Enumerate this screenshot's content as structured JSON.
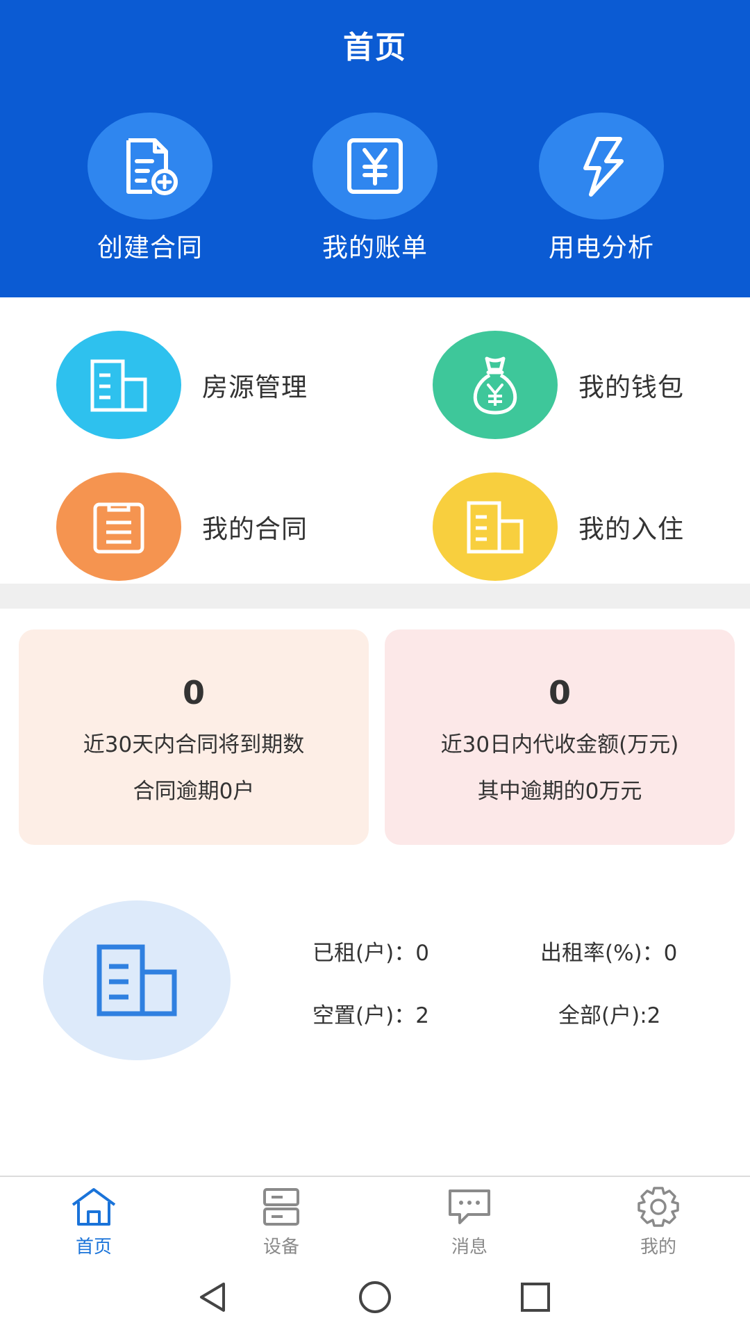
{
  "header": {
    "title": "首页",
    "actions": [
      {
        "label": "创建合同",
        "icon": "document-add-icon"
      },
      {
        "label": "我的账单",
        "icon": "yuan-bill-icon"
      },
      {
        "label": "用电分析",
        "icon": "lightning-icon"
      }
    ]
  },
  "grid": [
    {
      "label": "房源管理",
      "icon": "building-icon",
      "color": "#2ec1ee"
    },
    {
      "label": "我的钱包",
      "icon": "money-bag-icon",
      "color": "#3ec79a"
    },
    {
      "label": "我的合同",
      "icon": "clipboard-icon",
      "color": "#f59450"
    },
    {
      "label": "我的入住",
      "icon": "building-icon",
      "color": "#f8cf3e"
    }
  ],
  "cards": [
    {
      "value": "0",
      "line1": "近30天内合同将到期数",
      "line2": "合同逾期0户",
      "bg": "#fdeee6"
    },
    {
      "value": "0",
      "line1": "近30日内代收金额(万元)",
      "line2": "其中逾期的0万元",
      "bg": "#fce8e8"
    }
  ],
  "summary": {
    "icon": "building-icon",
    "rented": "已租(户)：0",
    "rate": "出租率(%)：0",
    "vacant": "空置(户)：2",
    "total": "全部(户):2"
  },
  "tabs": [
    {
      "label": "首页",
      "icon": "home-icon",
      "active": true
    },
    {
      "label": "设备",
      "icon": "device-icon",
      "active": false
    },
    {
      "label": "消息",
      "icon": "message-icon",
      "active": false
    },
    {
      "label": "我的",
      "icon": "gear-icon",
      "active": false
    }
  ],
  "colors": {
    "header_bg": "#0b5bd3",
    "header_circle": "#2f86ef",
    "tab_active": "#1a73d9",
    "tab_inactive": "#8a8a8a"
  }
}
